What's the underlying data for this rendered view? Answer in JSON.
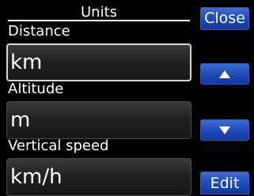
{
  "header": {
    "title": "Units"
  },
  "fields": [
    {
      "label": "Distance",
      "value": "km",
      "selected": true
    },
    {
      "label": "Altitude",
      "value": "m",
      "selected": false
    },
    {
      "label": "Vertical speed",
      "value": "km/h",
      "selected": false
    }
  ],
  "buttons": {
    "close_label": "Close",
    "up_icon": "arrow-up-icon",
    "down_icon": "arrow-down-icon",
    "edit_label": "Edit"
  },
  "colors": {
    "background": "#000000",
    "button_blue": "#1f4cb8",
    "field_fill": "#1e1e1e",
    "text": "#ffffff"
  }
}
